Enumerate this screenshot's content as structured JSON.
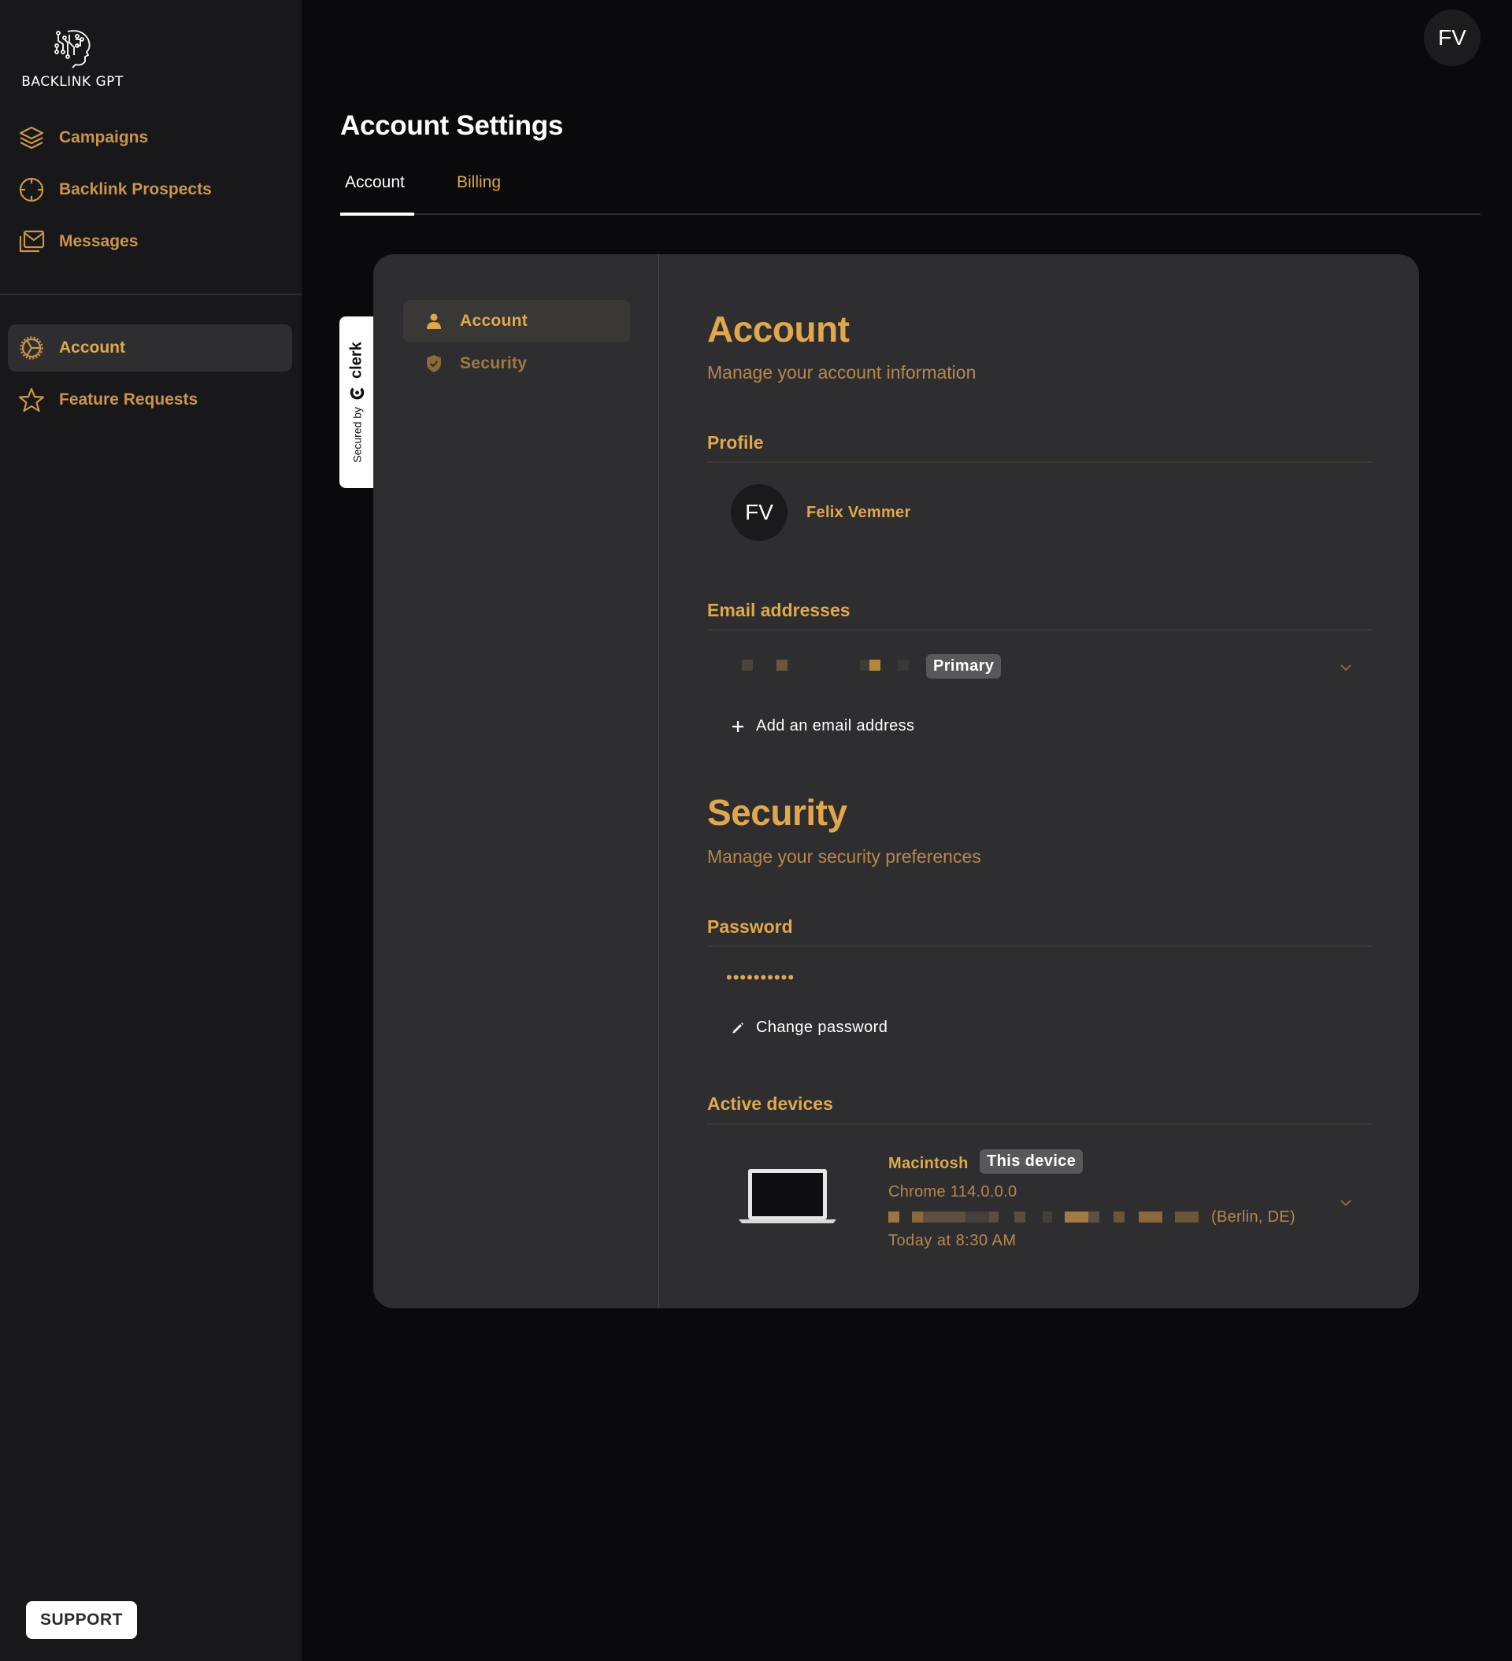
{
  "app": {
    "name": "BACKLINK GPT",
    "user_initials": "FV"
  },
  "colors": {
    "accent": "#e0a84a",
    "accent_muted": "#b8874a",
    "sidebar_bg": "#18181b",
    "page_bg": "#0a0a0c",
    "card_bg": "#2e2e30",
    "badge_bg": "#58585b"
  },
  "sidebar": {
    "primary_items": [
      {
        "label": "Campaigns",
        "icon": "layers-icon"
      },
      {
        "label": "Backlink Prospects",
        "icon": "crosshair-icon"
      },
      {
        "label": "Messages",
        "icon": "mail-stack-icon"
      }
    ],
    "secondary_items": [
      {
        "label": "Account",
        "icon": "gear-icon",
        "active": true
      },
      {
        "label": "Feature Requests",
        "icon": "star-icon",
        "active": false
      }
    ],
    "support_label": "SUPPORT"
  },
  "header": {
    "title": "Account Settings",
    "tabs": [
      {
        "label": "Account",
        "active": true
      },
      {
        "label": "Billing",
        "active": false
      }
    ]
  },
  "clerk_badge": {
    "prefix": "Secured by",
    "brand": "clerk"
  },
  "profile_card": {
    "nav": [
      {
        "label": "Account",
        "icon": "user-icon",
        "active": true
      },
      {
        "label": "Security",
        "icon": "shield-check-icon",
        "active": false
      }
    ],
    "account": {
      "title": "Account",
      "subtitle": "Manage your account information",
      "profile": {
        "section_title": "Profile",
        "avatar_initials": "FV",
        "name": "Felix Vemmer"
      },
      "emails": {
        "section_title": "Email addresses",
        "primary_badge": "Primary",
        "add_label": "Add an email address"
      }
    },
    "security": {
      "title": "Security",
      "subtitle": "Manage your security preferences",
      "password": {
        "section_title": "Password",
        "masked_value": "••••••••••",
        "change_label": "Change password"
      },
      "devices": {
        "section_title": "Active devices",
        "items": [
          {
            "name": "Macintosh",
            "badge": "This device",
            "browser": "Chrome 114.0.0.0",
            "location": "(Berlin, DE)",
            "last_active": "Today at 8:30 AM"
          }
        ]
      }
    }
  }
}
